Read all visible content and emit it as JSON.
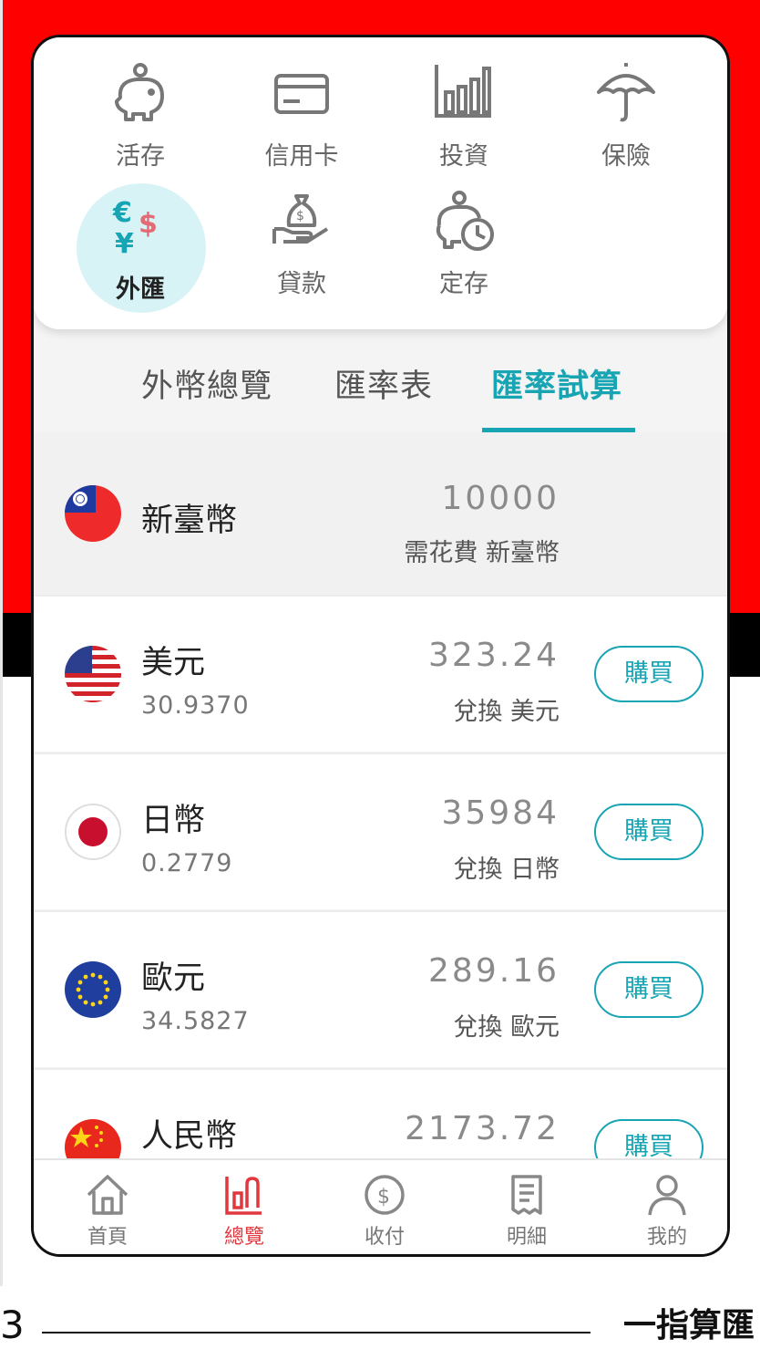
{
  "categories": [
    {
      "label": "活存",
      "icon": "piggy-bank-icon"
    },
    {
      "label": "信用卡",
      "icon": "credit-card-icon"
    },
    {
      "label": "投資",
      "icon": "bar-chart-icon"
    },
    {
      "label": "保險",
      "icon": "umbrella-icon"
    },
    {
      "label": "外匯",
      "icon": "currency-exchange-icon",
      "active": true
    },
    {
      "label": "貸款",
      "icon": "money-bag-hand-icon"
    },
    {
      "label": "定存",
      "icon": "piggy-clock-icon"
    }
  ],
  "tabs": [
    {
      "label": "外幣總覽"
    },
    {
      "label": "匯率表"
    },
    {
      "label": "匯率試算",
      "active": true
    }
  ],
  "base": {
    "name": "新臺幣",
    "amount": "10000",
    "sub": "需花費 新臺幣"
  },
  "currencies": [
    {
      "name": "美元",
      "rate": "30.9370",
      "amount": "323.24",
      "sub": "兌換 美元",
      "button": "購買"
    },
    {
      "name": "日幣",
      "rate": "0.2779",
      "amount": "35984",
      "sub": "兌換 日幣",
      "button": "購買"
    },
    {
      "name": "歐元",
      "rate": "34.5827",
      "amount": "289.16",
      "sub": "兌換 歐元",
      "button": "購買"
    },
    {
      "name": "人民幣",
      "rate": "",
      "amount": "2173.72",
      "sub": "",
      "button": "購買"
    }
  ],
  "nav": [
    {
      "label": "首頁",
      "icon": "home-icon"
    },
    {
      "label": "總覽",
      "icon": "overview-icon",
      "active": true
    },
    {
      "label": "收付",
      "icon": "dollar-coin-icon"
    },
    {
      "label": "明細",
      "icon": "receipt-icon"
    },
    {
      "label": "我的",
      "icon": "user-icon"
    }
  ],
  "footer": {
    "number": "3",
    "text": "一指算匯"
  },
  "colors": {
    "accent": "#17a4b3",
    "nav_active": "#e0383e",
    "frame_red": "#fe0000"
  }
}
